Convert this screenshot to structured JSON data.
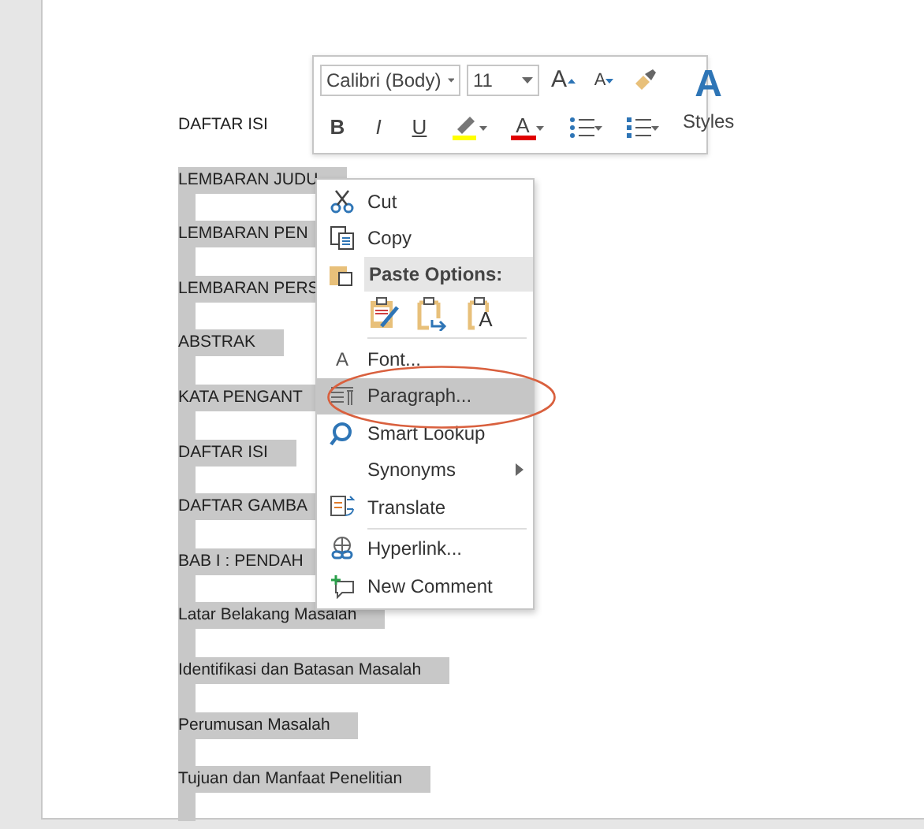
{
  "document": {
    "lines": [
      {
        "text": "DAFTAR ISI",
        "selected": false
      },
      {
        "text": "LEMBARAN JUDU",
        "selected": true
      },
      {
        "text": "LEMBARAN PEN",
        "selected": true
      },
      {
        "text": "LEMBARAN PERS",
        "selected": true
      },
      {
        "text": "ABSTRAK",
        "selected": true
      },
      {
        "text": "KATA PENGANT",
        "selected": true
      },
      {
        "text": "DAFTAR ISI",
        "selected": true
      },
      {
        "text": "DAFTAR GAMBA",
        "selected": true
      },
      {
        "text": "BAB I : PENDAH",
        "selected": true
      },
      {
        "text": "Latar Belakang Masalah",
        "selected": true
      },
      {
        "text": "Identifikasi dan Batasan Masalah",
        "selected": true
      },
      {
        "text": "Perumusan Masalah",
        "selected": true
      },
      {
        "text": "Tujuan dan Manfaat Penelitian",
        "selected": true
      }
    ]
  },
  "mini_toolbar": {
    "font": "Calibri (Body)",
    "size": "11",
    "grow_glyph": "A",
    "shrink_glyph": "A",
    "format_buttons": [
      "B",
      "I",
      "U"
    ],
    "font_color_glyph": "A",
    "styles_glyph": "A",
    "styles_label": "Styles"
  },
  "context_menu": {
    "items": [
      {
        "kind": "command",
        "label": "Cut",
        "selected": false
      },
      {
        "kind": "command",
        "label": "Copy",
        "selected": false
      },
      {
        "kind": "header",
        "label": "Paste Options:"
      },
      {
        "kind": "paste_row",
        "glyph": "A"
      },
      {
        "kind": "separator"
      },
      {
        "kind": "command",
        "glyph": "A",
        "label": "Font...",
        "selected": false
      },
      {
        "kind": "command",
        "label": "Paragraph...",
        "selected": true
      },
      {
        "kind": "command",
        "label": "Smart Lookup",
        "selected": false
      },
      {
        "kind": "command",
        "label": "Synonyms",
        "submenu": true,
        "selected": false
      },
      {
        "kind": "command",
        "label": "Translate",
        "selected": false
      },
      {
        "kind": "separator"
      },
      {
        "kind": "command",
        "label": "Hyperlink...",
        "selected": false
      },
      {
        "kind": "command",
        "label": "New Comment",
        "selected": false
      }
    ]
  }
}
